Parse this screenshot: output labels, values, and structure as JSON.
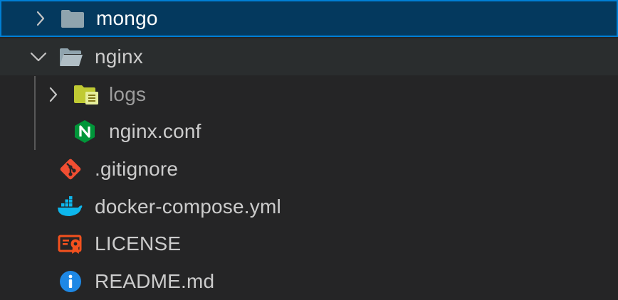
{
  "explorer": {
    "items": [
      {
        "label": "mongo",
        "kind": "folder",
        "expanded": false,
        "selected": true,
        "icon": "folder-icon"
      },
      {
        "label": "nginx",
        "kind": "folder",
        "expanded": true,
        "selected": false,
        "icon": "folder-open-icon"
      },
      {
        "label": "logs",
        "kind": "folder",
        "expanded": false,
        "selected": false,
        "icon": "logs-folder-icon"
      },
      {
        "label": "nginx.conf",
        "kind": "file",
        "selected": false,
        "icon": "nginx-icon"
      },
      {
        "label": ".gitignore",
        "kind": "file",
        "selected": false,
        "icon": "git-icon"
      },
      {
        "label": "docker-compose.yml",
        "kind": "file",
        "selected": false,
        "icon": "docker-icon"
      },
      {
        "label": "LICENSE",
        "kind": "file",
        "selected": false,
        "icon": "license-icon"
      },
      {
        "label": "README.md",
        "kind": "file",
        "selected": false,
        "icon": "info-icon"
      }
    ]
  },
  "colors": {
    "background": "#252526",
    "selection": "#04395e",
    "selection_border": "#007fd4",
    "text": "#cccccc",
    "folder": "#90a4ae",
    "logs_folder": "#c0ca33",
    "nginx": "#009639",
    "git": "#f14e32",
    "docker": "#0db7ed",
    "license": "#f4511e",
    "info": "#1e88e5"
  }
}
